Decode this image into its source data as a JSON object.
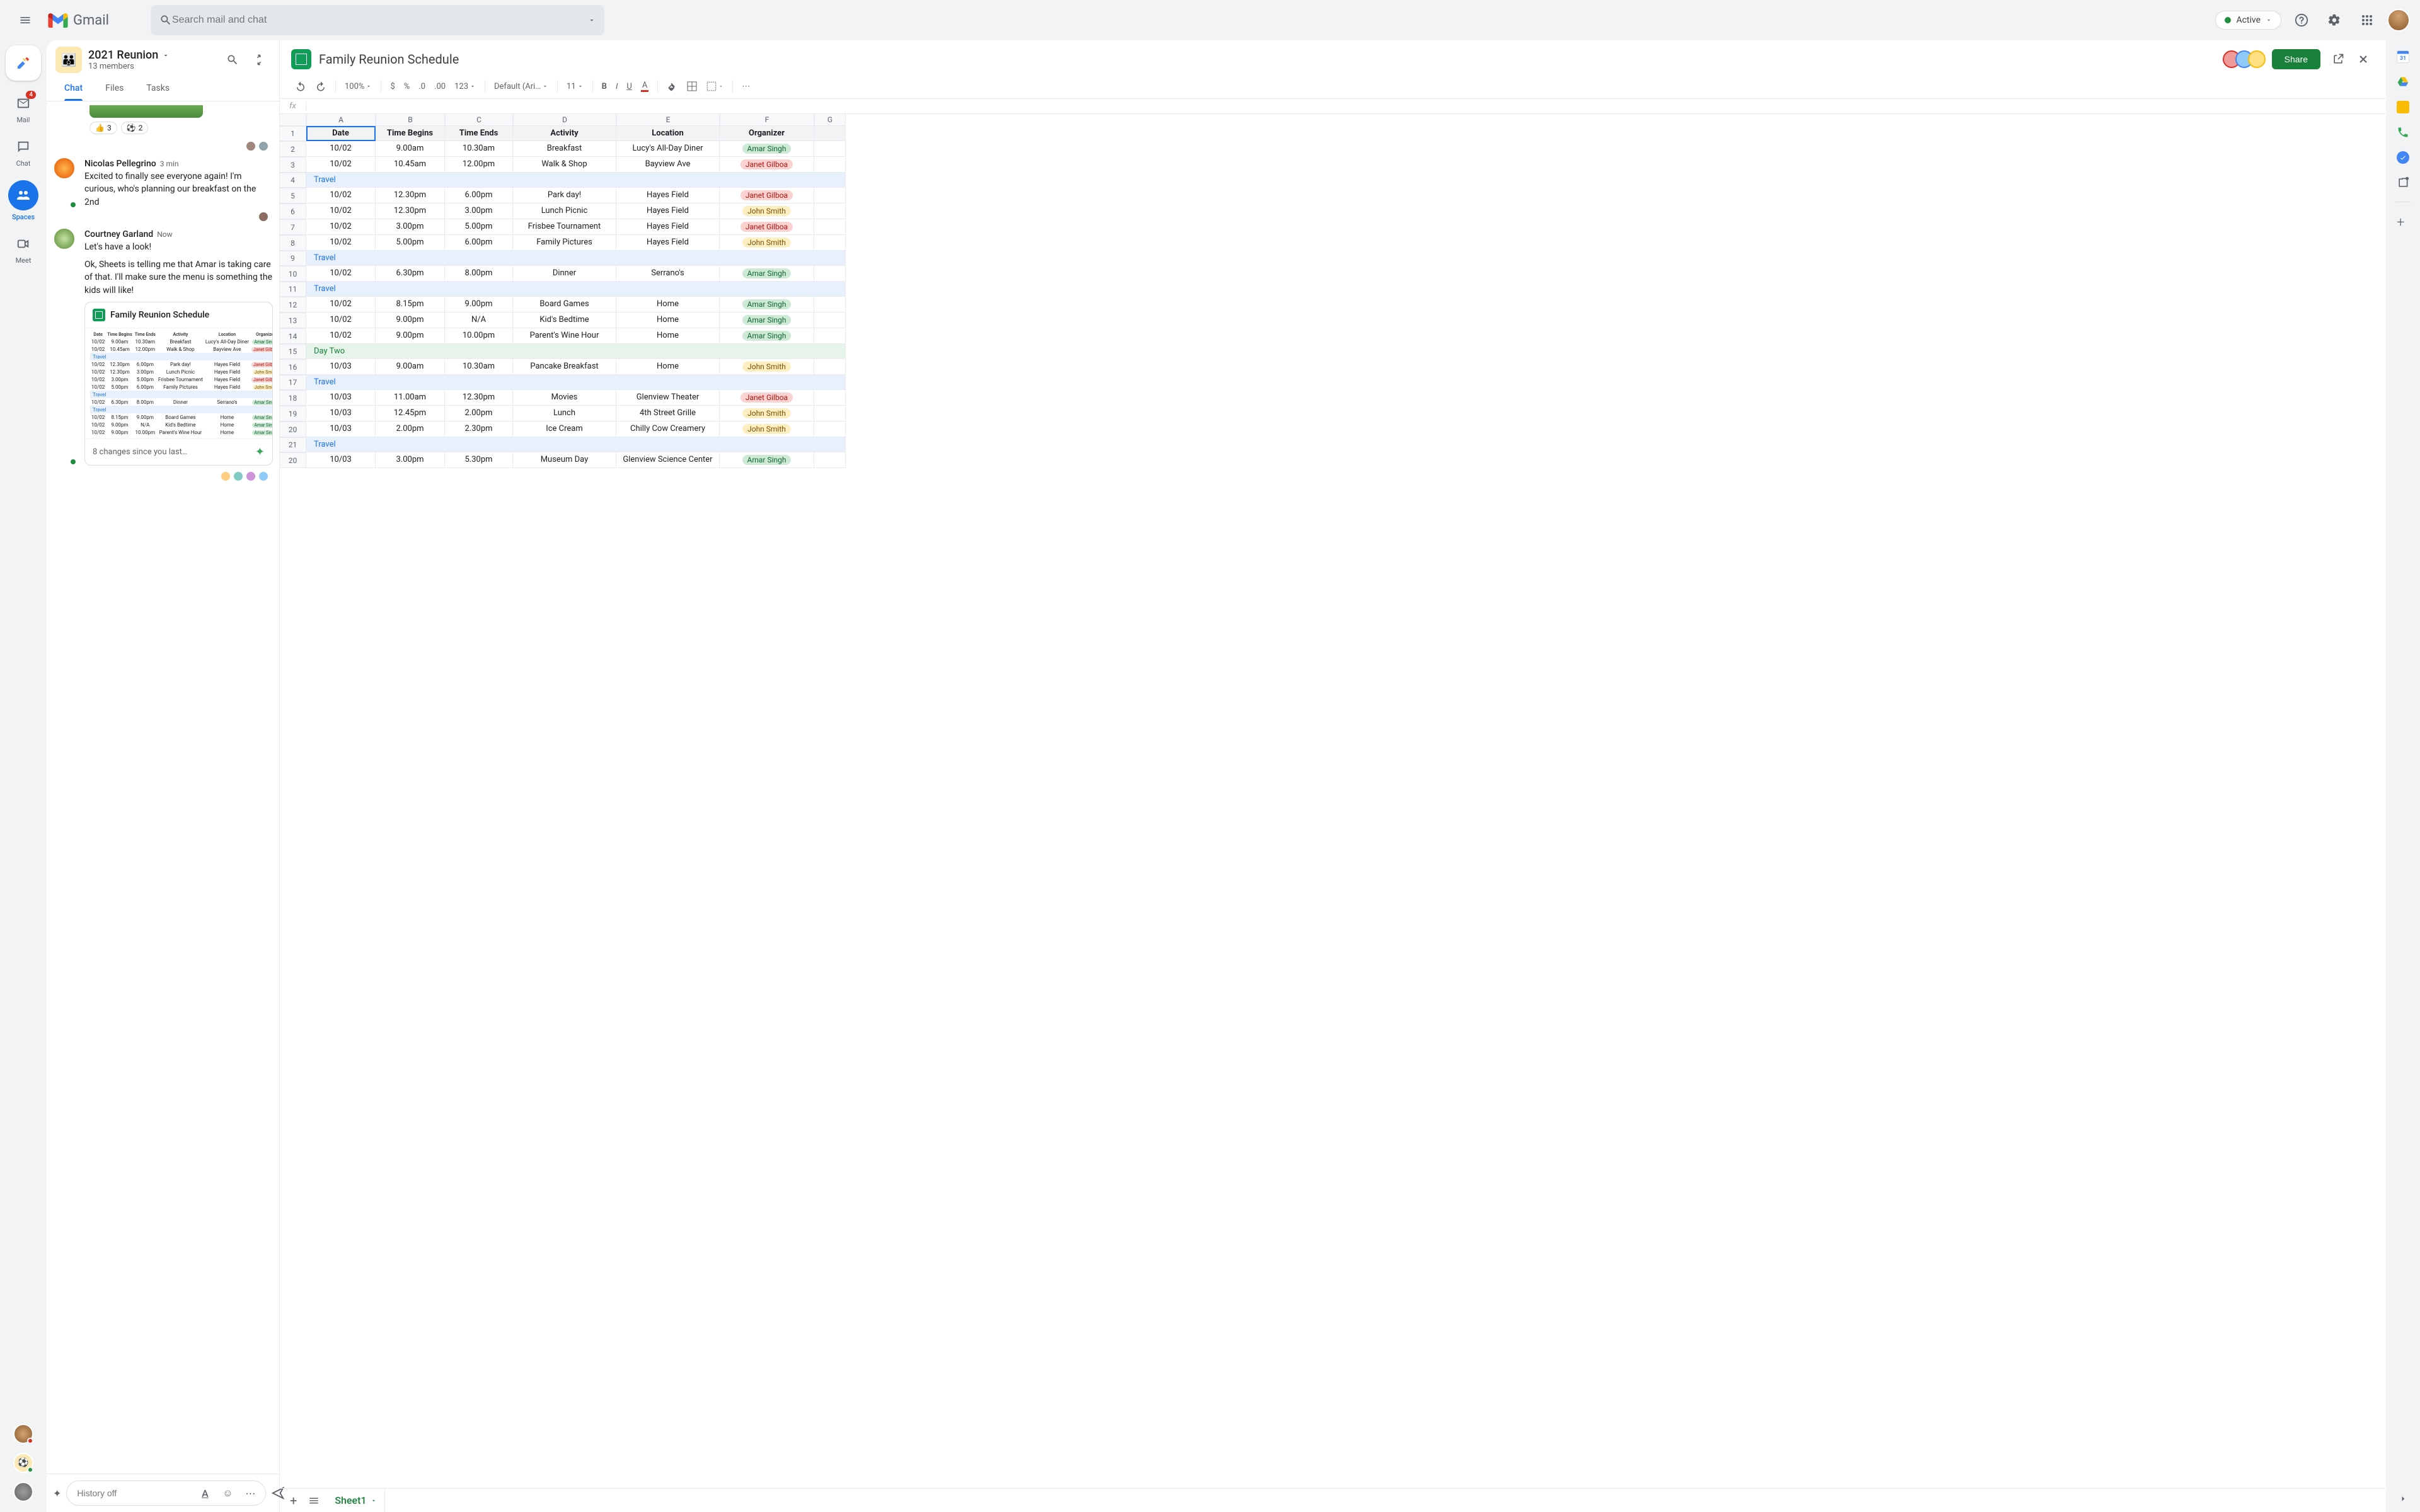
{
  "header": {
    "app_name": "Gmail",
    "search_placeholder": "Search mail and chat",
    "status_label": "Active"
  },
  "rail": {
    "items": [
      {
        "label": "Mail",
        "badge": "4"
      },
      {
        "label": "Chat"
      },
      {
        "label": "Spaces"
      },
      {
        "label": "Meet"
      }
    ]
  },
  "space": {
    "title": "2021 Reunion",
    "members": "13 members",
    "tabs": [
      "Chat",
      "Files",
      "Tasks"
    ],
    "reactions": [
      {
        "emoji": "👍",
        "count": "3"
      },
      {
        "emoji": "⚽",
        "count": "2"
      }
    ],
    "messages": [
      {
        "author": "Nicolas Pellegrino",
        "time": "3 min",
        "text": "Excited to finally see everyone again! I'm curious, who's planning our breakfast on the 2nd"
      },
      {
        "author": "Courtney Garland",
        "time": "Now",
        "text1": "Let's have a look!",
        "text2": "Ok, Sheets is telling me that Amar is taking care of that. I'll make sure the menu is something the kids will like!"
      }
    ],
    "sheet_card": {
      "title": "Family Reunion Schedule",
      "footer": "8 changes since you last…"
    },
    "input_placeholder": "History off"
  },
  "sheets": {
    "title": "Family Reunion Schedule",
    "share": "Share",
    "zoom": "100%",
    "font": "Default (Ari…",
    "font_size": "11",
    "number_format": "123",
    "sheet_tab": "Sheet1",
    "columns": [
      "A",
      "B",
      "C",
      "D",
      "E",
      "F",
      "G"
    ],
    "headers": [
      "Date",
      "Time Begins",
      "Time Ends",
      "Activity",
      "Location",
      "Organizer"
    ],
    "rows": [
      {
        "n": 2,
        "date": "10/02",
        "begin": "9.00am",
        "end": "10.30am",
        "act": "Breakfast",
        "loc": "Lucy's All-Day Diner",
        "org": "Amar Singh",
        "c": "teal"
      },
      {
        "n": 3,
        "date": "10/02",
        "begin": "10.45am",
        "end": "12.00pm",
        "act": "Walk & Shop",
        "loc": "Bayview Ave",
        "org": "Janet Gilboa",
        "c": "pink"
      },
      {
        "n": 4,
        "section": "Travel",
        "cls": "section-blue"
      },
      {
        "n": 5,
        "date": "10/02",
        "begin": "12.30pm",
        "end": "6.00pm",
        "act": "Park day!",
        "loc": "Hayes Field",
        "org": "Janet Gilboa",
        "c": "pink"
      },
      {
        "n": 6,
        "date": "10/02",
        "begin": "12.30pm",
        "end": "3.00pm",
        "act": "Lunch Picnic",
        "loc": "Hayes Field",
        "org": "John Smith",
        "c": "yellow"
      },
      {
        "n": 7,
        "date": "10/02",
        "begin": "3.00pm",
        "end": "5.00pm",
        "act": "Frisbee Tournament",
        "loc": "Hayes Field",
        "org": "Janet Gilboa",
        "c": "pink"
      },
      {
        "n": 8,
        "date": "10/02",
        "begin": "5.00pm",
        "end": "6.00pm",
        "act": "Family Pictures",
        "loc": "Hayes Field",
        "org": "John Smith",
        "c": "yellow"
      },
      {
        "n": 9,
        "section": "Travel",
        "cls": "section-blue"
      },
      {
        "n": 10,
        "date": "10/02",
        "begin": "6.30pm",
        "end": "8.00pm",
        "act": "Dinner",
        "loc": "Serrano's",
        "org": "Amar Singh",
        "c": "teal"
      },
      {
        "n": 11,
        "section": "Travel",
        "cls": "section-blue"
      },
      {
        "n": 12,
        "date": "10/02",
        "begin": "8.15pm",
        "end": "9.00pm",
        "act": "Board Games",
        "loc": "Home",
        "org": "Amar Singh",
        "c": "teal"
      },
      {
        "n": 13,
        "date": "10/02",
        "begin": "9.00pm",
        "end": "N/A",
        "act": "Kid's Bedtime",
        "loc": "Home",
        "org": "Amar Singh",
        "c": "teal"
      },
      {
        "n": 14,
        "date": "10/02",
        "begin": "9.00pm",
        "end": "10.00pm",
        "act": "Parent's Wine Hour",
        "loc": "Home",
        "org": "Amar Singh",
        "c": "teal"
      },
      {
        "n": 15,
        "section": "Day Two",
        "cls": "section-green"
      },
      {
        "n": 16,
        "date": "10/03",
        "begin": "9.00am",
        "end": "10.30am",
        "act": "Pancake Breakfast",
        "loc": "Home",
        "org": "John Smith",
        "c": "yellow"
      },
      {
        "n": 17,
        "section": "Travel",
        "cls": "section-blue"
      },
      {
        "n": 18,
        "date": "10/03",
        "begin": "11.00am",
        "end": "12.30pm",
        "act": "Movies",
        "loc": "Glenview Theater",
        "org": "Janet Gilboa",
        "c": "pink"
      },
      {
        "n": 19,
        "date": "10/03",
        "begin": "12.45pm",
        "end": "2.00pm",
        "act": "Lunch",
        "loc": "4th Street Grille",
        "org": "John Smith",
        "c": "yellow"
      },
      {
        "n": 20,
        "date": "10/03",
        "begin": "2.00pm",
        "end": "2.30pm",
        "act": "Ice Cream",
        "loc": "Chilly Cow Creamery",
        "org": "John Smith",
        "c": "yellow"
      },
      {
        "n": 21,
        "section": "Travel",
        "cls": "section-blue"
      },
      {
        "n": 20,
        "date": "10/03",
        "begin": "3.00pm",
        "end": "5.30pm",
        "act": "Museum Day",
        "loc": "Glenview Science Center",
        "org": "Amar Singh",
        "c": "teal"
      }
    ]
  }
}
